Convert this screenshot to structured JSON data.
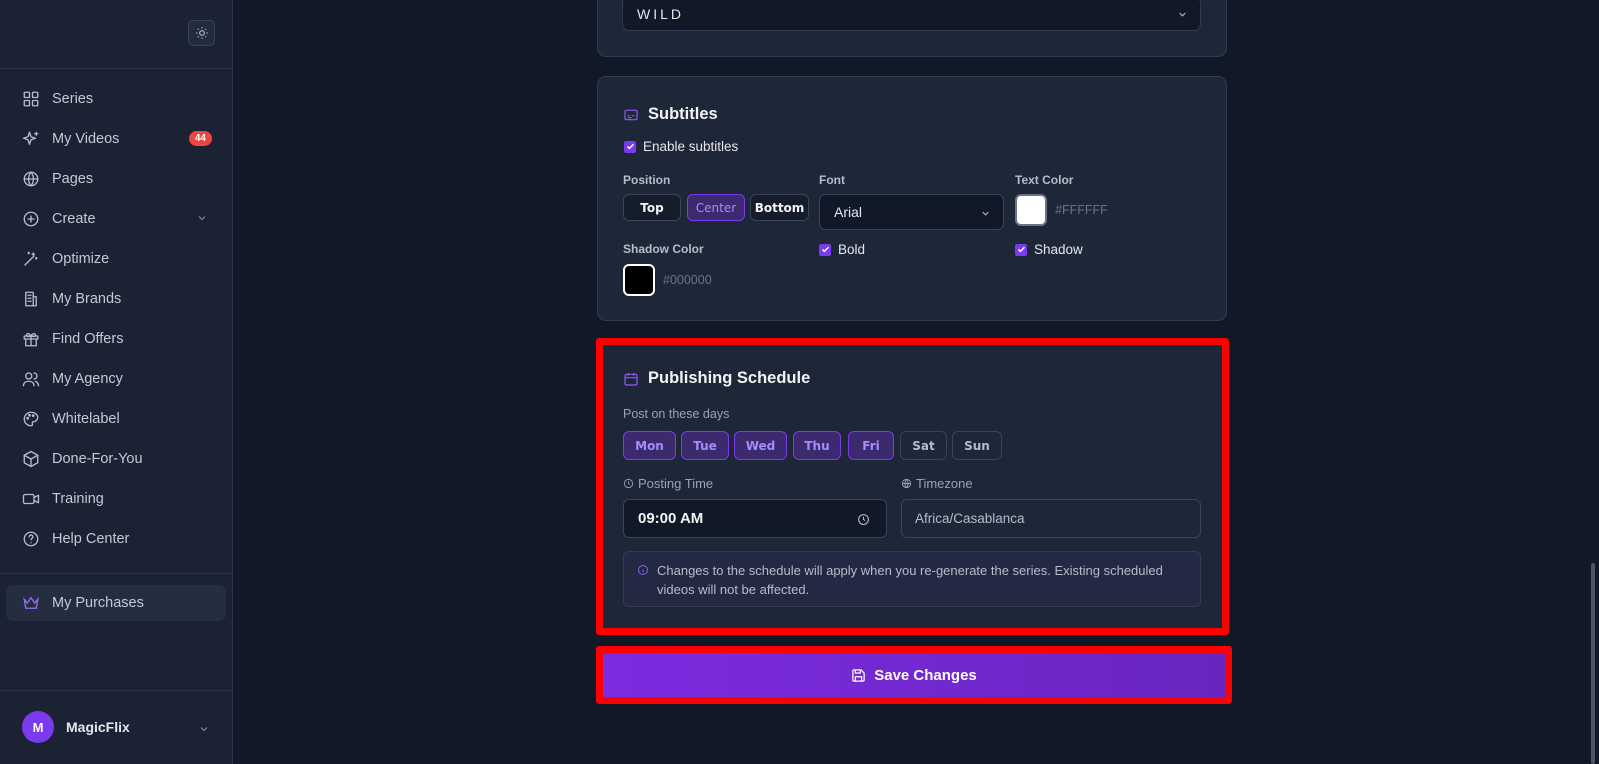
{
  "sidebar": {
    "items": [
      {
        "label": "Series",
        "icon": "grid-icon"
      },
      {
        "label": "My Videos",
        "icon": "sparkles-icon",
        "badge": "44"
      },
      {
        "label": "Pages",
        "icon": "globe-icon"
      },
      {
        "label": "Create",
        "icon": "plus-circle-icon"
      },
      {
        "label": "Optimize",
        "icon": "magic-wand-icon"
      },
      {
        "label": "My Brands",
        "icon": "building-icon"
      },
      {
        "label": "Find Offers",
        "icon": "gift-icon"
      },
      {
        "label": "My Agency",
        "icon": "users-icon"
      },
      {
        "label": "Whitelabel",
        "icon": "palette-icon"
      },
      {
        "label": "Done-For-You",
        "icon": "box-icon"
      },
      {
        "label": "Training",
        "icon": "video-icon"
      },
      {
        "label": "Help Center",
        "icon": "help-circle-icon"
      }
    ],
    "purchases": "My Purchases",
    "user": {
      "initial": "M",
      "name": "MagicFlix"
    }
  },
  "style_select": {
    "value": "WILD"
  },
  "subtitles": {
    "title": "Subtitles",
    "enable_label": "Enable subtitles",
    "position_label": "Position",
    "positions": [
      "Top",
      "Center",
      "Bottom"
    ],
    "active_position": "Center",
    "font_label": "Font",
    "font_value": "Arial",
    "text_color_label": "Text Color",
    "text_color": "#FFFFFF",
    "shadow_color_label": "Shadow Color",
    "shadow_color": "#000000",
    "bold_label": "Bold",
    "shadow_label": "Shadow"
  },
  "schedule": {
    "title": "Publishing Schedule",
    "days_label": "Post on these days",
    "days": [
      "Mon",
      "Tue",
      "Wed",
      "Thu",
      "Fri",
      "Sat",
      "Sun"
    ],
    "selected_days": [
      "Mon",
      "Tue",
      "Wed",
      "Thu",
      "Fri"
    ],
    "time_label": "Posting Time",
    "time_value": "09:00 AM",
    "tz_label": "Timezone",
    "tz_value": "Africa/Casablanca",
    "info": "Changes to the schedule will apply when you re-generate the series. Existing scheduled videos will not be affected."
  },
  "save_label": "Save Changes",
  "colors": {
    "accent": "#7c3aed",
    "highlight": "#ff0000"
  }
}
